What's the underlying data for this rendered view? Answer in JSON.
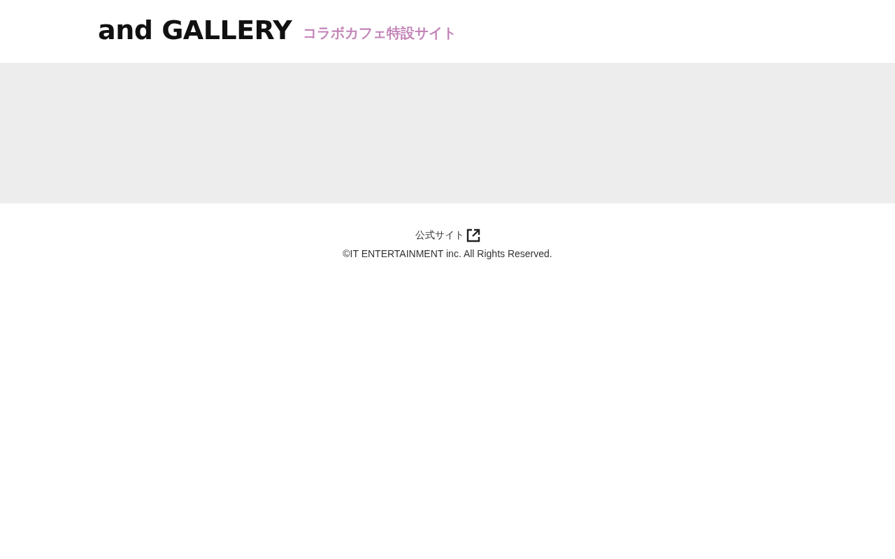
{
  "header": {
    "logo": "and GALLERY",
    "subtitle": "コラボカフェ特設サイト"
  },
  "footer": {
    "links": [
      {
        "label": "公式サイト",
        "external": true
      }
    ],
    "copyright": "©IT ENTERTAINMENT inc. All Rights Reserved."
  }
}
